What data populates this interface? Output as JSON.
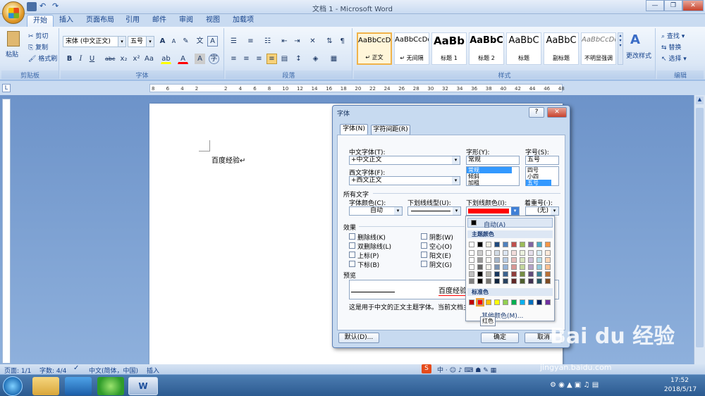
{
  "window": {
    "title": "文档 1 - Microsoft Word",
    "min": "—",
    "max": "❐",
    "close": "✕"
  },
  "tabs": [
    "开始",
    "插入",
    "页面布局",
    "引用",
    "邮件",
    "审阅",
    "视图",
    "加载项"
  ],
  "ribbon": {
    "clipboard": {
      "paste": "粘贴",
      "cut": "剪切",
      "copy": "复制",
      "format_painter": "格式刷",
      "label": "剪贴板"
    },
    "font": {
      "name": "宋体 (中文正文)",
      "size": "五号",
      "label": "字体"
    },
    "paragraph": {
      "label": "段落"
    },
    "styles": {
      "items": [
        {
          "sample": "AaBbCcDd",
          "name": "↵ 正文"
        },
        {
          "sample": "AaBbCcDd",
          "name": "↵ 无间隔"
        },
        {
          "sample": "AaBb",
          "name": "标题 1"
        },
        {
          "sample": "AaBbC",
          "name": "标题 2"
        },
        {
          "sample": "AaBbC",
          "name": "标题"
        },
        {
          "sample": "AaBbC",
          "name": "副标题"
        },
        {
          "sample": "AaBbCcDd",
          "name": "不明显强调"
        }
      ],
      "change": "更改样式",
      "label": "样式"
    },
    "editing": {
      "find": "查找 ▾",
      "replace": "替换",
      "select": "选择 ▾",
      "label": "编辑"
    }
  },
  "ruler": {
    "ticks": [
      "8",
      "6",
      "4",
      "2",
      "",
      "2",
      "4",
      "6",
      "8",
      "10",
      "12",
      "14",
      "16",
      "18",
      "20",
      "22",
      "24",
      "26",
      "28",
      "30",
      "32",
      "34",
      "36",
      "38",
      "40",
      "42",
      "44",
      "46",
      "48"
    ]
  },
  "document": {
    "text": "百度经验↵"
  },
  "dialog": {
    "title": "字体",
    "help": "?",
    "close": "✕",
    "tabs": [
      "字体(N)",
      "字符间距(R)"
    ],
    "cn_font_label": "中文字体(T):",
    "cn_font": "+中文正文",
    "west_font_label": "西文字体(F):",
    "west_font": "+西文正文",
    "style_label": "字形(Y):",
    "style_value": "常规",
    "style_list": [
      "常规",
      "倾斜",
      "加粗"
    ],
    "size_label": "字号(S):",
    "size_value": "五号",
    "size_list": [
      "四号",
      "小四",
      "五号"
    ],
    "all_text": "所有文字",
    "font_color_label": "字体颜色(C):",
    "font_color": "自动",
    "underline_type_label": "下划线线型(U):",
    "underline_color_label": "下划线颜色(I):",
    "emphasis_label": "着重号(·):",
    "emphasis": "(无)",
    "effects_label": "效果",
    "effects_left": [
      "删除线(K)",
      "双删除线(L)",
      "上标(P)",
      "下标(B)"
    ],
    "effects_mid": [
      "阴影(W)",
      "空心(O)",
      "阳文(E)",
      "阴文(G)"
    ],
    "preview_label": "预览",
    "preview_text": "百度经验",
    "note": "这是用于中文的正文主题字体。当前文档主",
    "default_btn": "默认(D)...",
    "ok": "确定",
    "cancel": "取消"
  },
  "palette": {
    "auto": "自动(A)",
    "theme": "主题颜色",
    "standard": "标准色",
    "more": "其他颜色(M)...",
    "tooltip": "红色",
    "theme_top": [
      "#ffffff",
      "#000000",
      "#eeece1",
      "#1f497d",
      "#4f81bd",
      "#c0504d",
      "#9bbb59",
      "#8064a2",
      "#4bacc6",
      "#f79646"
    ],
    "standard_colors": [
      "#c00000",
      "#ff0000",
      "#ffc000",
      "#ffff00",
      "#92d050",
      "#00b050",
      "#00b0f0",
      "#0070c0",
      "#002060",
      "#7030a0"
    ]
  },
  "status": {
    "page": "页面: 1/1",
    "words": "字数: 4/4",
    "lang": "中文(简体，中国)",
    "mode": "插入"
  },
  "clock": {
    "time": "17:52",
    "date": "2018/5/17"
  },
  "watermark": {
    "brand": "Bai du 经验",
    "url": "jingyan.baidu.com"
  },
  "colors": {
    "accent": "#15428b",
    "selected_red": "#ff0000",
    "highlight": "#3399ff"
  }
}
